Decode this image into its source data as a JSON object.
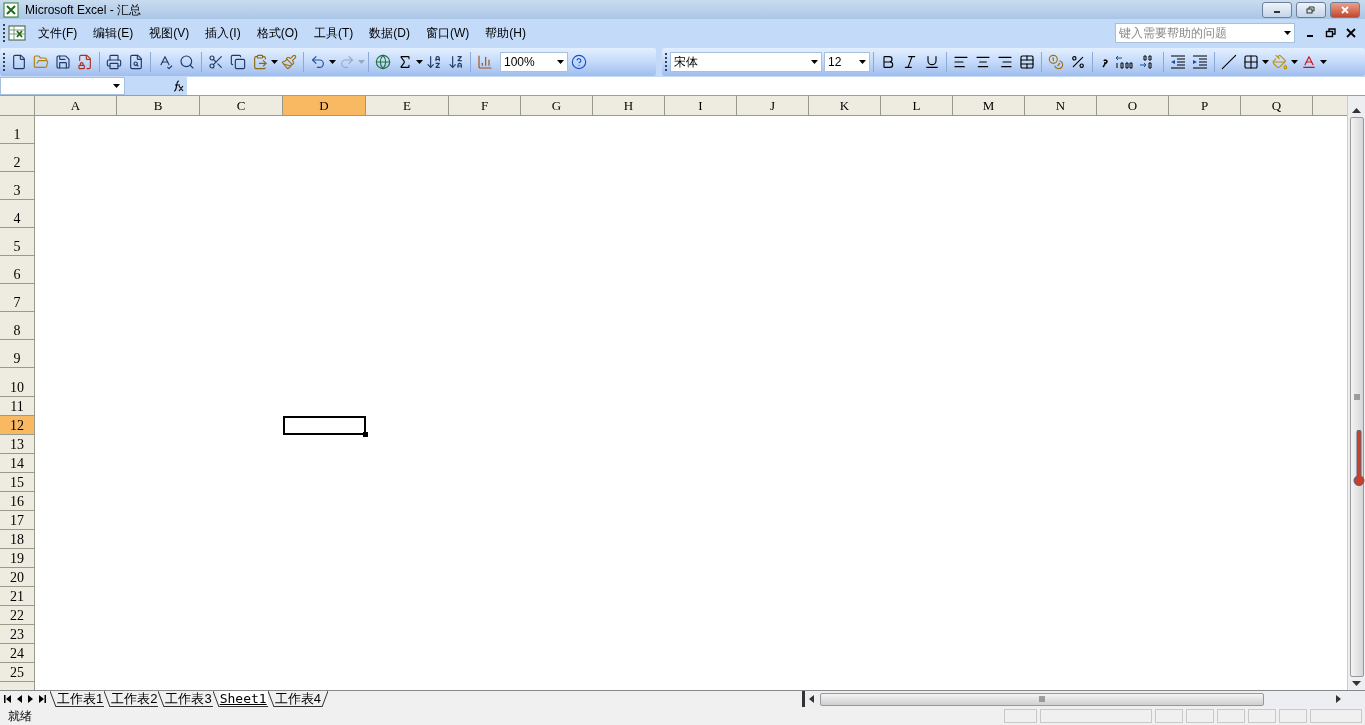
{
  "window": {
    "title": "Microsoft Excel - 汇总"
  },
  "menu": [
    {
      "label": "文件(F)"
    },
    {
      "label": "编辑(E)"
    },
    {
      "label": "视图(V)"
    },
    {
      "label": "插入(I)"
    },
    {
      "label": "格式(O)"
    },
    {
      "label": "工具(T)"
    },
    {
      "label": "数据(D)"
    },
    {
      "label": "窗口(W)"
    },
    {
      "label": "帮助(H)"
    }
  ],
  "help_box": {
    "placeholder": "键入需要帮助的问题"
  },
  "standard_toolbar": {
    "zoom": "100%",
    "redo_disabled": true
  },
  "formatting_toolbar": {
    "font": "宋体",
    "font_size": "12"
  },
  "columns": [
    {
      "label": "A",
      "selected": false
    },
    {
      "label": "B",
      "selected": false
    },
    {
      "label": "C",
      "selected": false
    },
    {
      "label": "D",
      "selected": true
    },
    {
      "label": "E",
      "selected": false
    },
    {
      "label": "F",
      "selected": false
    },
    {
      "label": "G",
      "selected": false
    },
    {
      "label": "H",
      "selected": false
    },
    {
      "label": "I",
      "selected": false
    },
    {
      "label": "J",
      "selected": false
    },
    {
      "label": "K",
      "selected": false
    },
    {
      "label": "L",
      "selected": false
    },
    {
      "label": "M",
      "selected": false
    },
    {
      "label": "N",
      "selected": false
    },
    {
      "label": "O",
      "selected": false
    },
    {
      "label": "P",
      "selected": false
    },
    {
      "label": "Q",
      "selected": false
    }
  ],
  "rows": [
    {
      "label": "1",
      "selected": false
    },
    {
      "label": "2",
      "selected": false
    },
    {
      "label": "3",
      "selected": false
    },
    {
      "label": "4",
      "selected": false
    },
    {
      "label": "5",
      "selected": false
    },
    {
      "label": "6",
      "selected": false
    },
    {
      "label": "7",
      "selected": false
    },
    {
      "label": "8",
      "selected": false
    },
    {
      "label": "9",
      "selected": false
    },
    {
      "label": "10",
      "selected": false
    },
    {
      "label": "11",
      "selected": false
    },
    {
      "label": "12",
      "selected": true
    },
    {
      "label": "13",
      "selected": false
    },
    {
      "label": "14",
      "selected": false
    },
    {
      "label": "15",
      "selected": false
    },
    {
      "label": "16",
      "selected": false
    },
    {
      "label": "17",
      "selected": false
    },
    {
      "label": "18",
      "selected": false
    },
    {
      "label": "19",
      "selected": false
    },
    {
      "label": "20",
      "selected": false
    },
    {
      "label": "21",
      "selected": false
    },
    {
      "label": "22",
      "selected": false
    },
    {
      "label": "23",
      "selected": false
    },
    {
      "label": "24",
      "selected": false
    },
    {
      "label": "25",
      "selected": false
    }
  ],
  "sheet_tabs": [
    {
      "label": "工作表1",
      "selected": false
    },
    {
      "label": "工作表2",
      "selected": false
    },
    {
      "label": "工作表3",
      "selected": false
    },
    {
      "label": "Sheet1",
      "selected": true
    },
    {
      "label": "工作表4",
      "selected": false
    }
  ],
  "status_bar": {
    "text": "就绪"
  }
}
